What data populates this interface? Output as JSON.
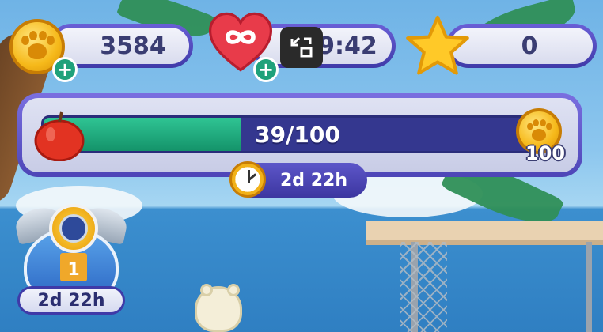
{
  "hud": {
    "coins": "3584",
    "lives_timer": "09:42",
    "stars": "0"
  },
  "progress": {
    "label": "39/100",
    "current": 39,
    "max": 100,
    "reward_amount": "100",
    "time_left": "2d 22h"
  },
  "badge": {
    "rank": "1",
    "time_left": "2d 22h"
  },
  "icons": {
    "coins": "paw-coin-icon",
    "lives": "infinite-heart-icon",
    "stars": "star-icon",
    "progress_item": "apple-icon",
    "reward": "paw-coin-icon",
    "timer": "stopwatch-icon",
    "badge": "winged-medal-icon",
    "overlay": "exit-fullscreen-icon"
  },
  "colors": {
    "pill_border": "#4f47b8",
    "bar_fill": "#1fae7f",
    "bar_track": "#34378f",
    "plus_button": "#1fa17a",
    "coin": "#f6b91a"
  }
}
